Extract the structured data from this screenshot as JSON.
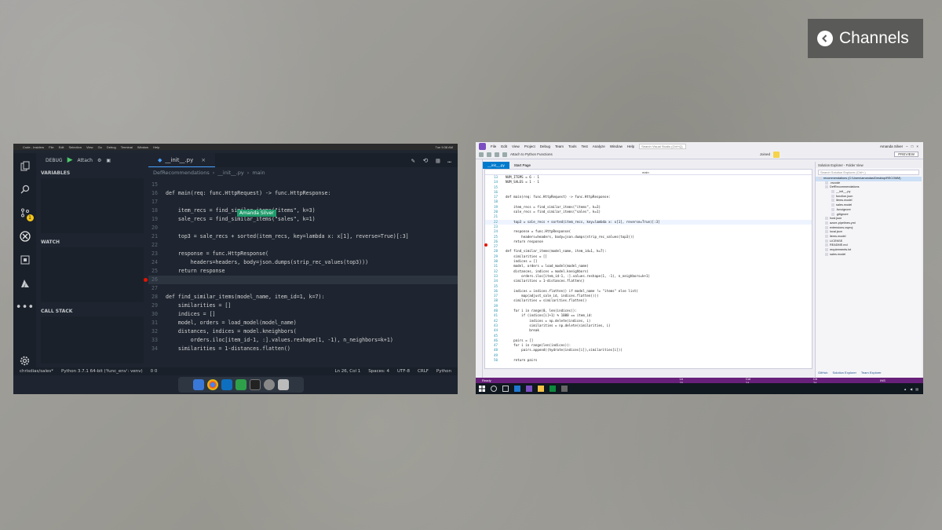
{
  "overlay": {
    "channels_label": "Channels"
  },
  "left_window": {
    "mac_menu": [
      "Code - Insiders",
      "File",
      "Edit",
      "Selection",
      "View",
      "Go",
      "Debug",
      "Terminal",
      "Window",
      "Help"
    ],
    "mac_clock": "Tue 9:38 AM",
    "debug_label": "DEBUG",
    "attach_label": "Attach",
    "sections": {
      "variables": "VARIABLES",
      "watch": "WATCH",
      "call_stack": "CALL STACK"
    },
    "tab_label": "__init__.py",
    "breadcrumbs": [
      "DefRecommendations",
      "__init__.py",
      "main"
    ],
    "live_share_user": "Amanda Silver",
    "code": [
      {
        "n": "15",
        "t": ""
      },
      {
        "n": "16",
        "t": "def main(req: func.HttpRequest) -> func.HttpResponse:"
      },
      {
        "n": "17",
        "t": ""
      },
      {
        "n": "18",
        "t": "    item_recs = find_similar_items(\"items\", k=3)"
      },
      {
        "n": "19",
        "t": "    sale_recs = find_similar_items(\"sales\", k=1)"
      },
      {
        "n": "20",
        "t": ""
      },
      {
        "n": "21",
        "t": "    top3 = sale_recs + sorted(item_recs, key=lambda x: x[1], reverse=True)[:3]"
      },
      {
        "n": "22",
        "t": ""
      },
      {
        "n": "23",
        "t": "    response = func.HttpResponse("
      },
      {
        "n": "24",
        "t": "        headers=headers, body=json.dumps(strip_rec_values(top3)))"
      },
      {
        "n": "25",
        "t": "    return response"
      },
      {
        "n": "26",
        "t": ""
      },
      {
        "n": "27",
        "t": ""
      },
      {
        "n": "28",
        "t": "def find_similar_items(model_name, item_id=1, k=7):"
      },
      {
        "n": "29",
        "t": "    similarities = []"
      },
      {
        "n": "30",
        "t": "    indices = []"
      },
      {
        "n": "31",
        "t": "    model, orders = load_model(model_name)"
      },
      {
        "n": "32",
        "t": "    distances, indices = model.kneighbors("
      },
      {
        "n": "33",
        "t": "        orders.iloc[item_id-1, :].values.reshape(1, -1), n_neighbors=k+1)"
      },
      {
        "n": "34",
        "t": "    similarities = 1-distances.flatten()"
      }
    ],
    "status": {
      "branch": "chrisdias/sales*",
      "interpreter": "Python 3.7.1 64-bit ('func_env': venv)",
      "problems": "0 0",
      "position": "Ln 26, Col 1",
      "spaces": "Spaces: 4",
      "encoding": "UTF-8",
      "eol": "CRLF",
      "language": "Python"
    }
  },
  "right_window": {
    "menu": [
      "File",
      "Edit",
      "View",
      "Project",
      "Debug",
      "Team",
      "Tools",
      "Test",
      "Analyze",
      "Window",
      "Help"
    ],
    "search_placeholder": "Search Visual Studio (Ctrl+Q)",
    "user": "Amanda Silver",
    "toolbar_attach": "Attach to Python Functions",
    "toolbar_status": "Joined",
    "preview_label": "PREVIEW",
    "tabs": [
      "__init__.py",
      "Start Page"
    ],
    "breadcrumb": "main",
    "code": [
      {
        "n": "13",
        "t": "NUM_ITEMS = 6 - 1"
      },
      {
        "n": "14",
        "t": "NUM_SALES = 1 - 1"
      },
      {
        "n": "15",
        "t": ""
      },
      {
        "n": "16",
        "t": ""
      },
      {
        "n": "17",
        "t": "def main(req: func.HttpRequest) -> func.HttpResponse:"
      },
      {
        "n": "18",
        "t": ""
      },
      {
        "n": "19",
        "t": "    item_recs = find_similar_items(\"items\", k=3)"
      },
      {
        "n": "20",
        "t": "    sale_recs = find_similar_items(\"sales\", k=1)"
      },
      {
        "n": "21",
        "t": ""
      },
      {
        "n": "22",
        "t": "    top3 = sale_recs + sorted(item_recs, key=lambda x: x[1], reverse=True)[:3]"
      },
      {
        "n": "23",
        "t": ""
      },
      {
        "n": "24",
        "t": "    response = func.HttpResponse("
      },
      {
        "n": "25",
        "t": "        headers=headers, body=json.dumps(strip_rec_values(top3)))"
      },
      {
        "n": "26",
        "t": "    return response"
      },
      {
        "n": "27",
        "t": ""
      },
      {
        "n": "28",
        "t": "def find_similar_items(model_name, item_id=1, k=7):"
      },
      {
        "n": "29",
        "t": "    similarities = []"
      },
      {
        "n": "30",
        "t": "    indices = []"
      },
      {
        "n": "31",
        "t": "    model, orders = load_model(model_name)"
      },
      {
        "n": "32",
        "t": "    distances, indices = model.kneighbors("
      },
      {
        "n": "33",
        "t": "        orders.iloc[item_id-1, :].values.reshape(1, -1), n_neighbors=k+1)"
      },
      {
        "n": "34",
        "t": "    similarities = 1-distances.flatten()"
      },
      {
        "n": "35",
        "t": ""
      },
      {
        "n": "36",
        "t": "    indices = indices.flatten() if model_name != \"items\" else list("
      },
      {
        "n": "37",
        "t": "        map(adjust_sale_id, indices.flatten()))"
      },
      {
        "n": "38",
        "t": "    similarities = similarities.flatten()"
      },
      {
        "n": "39",
        "t": ""
      },
      {
        "n": "40",
        "t": "    for i in range(0, len(indices)):"
      },
      {
        "n": "41",
        "t": "        if (indices[i]+1) % 1000 == item_id:"
      },
      {
        "n": "42",
        "t": "            indices = np.delete(indices, i)"
      },
      {
        "n": "43",
        "t": "            similarities = np.delete(similarities, i)"
      },
      {
        "n": "44",
        "t": "            break"
      },
      {
        "n": "45",
        "t": ""
      },
      {
        "n": "46",
        "t": "    pairs = []"
      },
      {
        "n": "47",
        "t": "    for i in range(len(indices)):"
      },
      {
        "n": "48",
        "t": "        pairs.append((hydrate(indices[i]),similarities[i]))"
      },
      {
        "n": "49",
        "t": ""
      },
      {
        "n": "50",
        "t": "    return pairs"
      }
    ],
    "solution_title": "Solution Explorer - Folder View",
    "solution_search": "Search Solution Explorer (Ctrl+;)",
    "solution_items": [
      "recommendations (C:\\Users\\amandas\\Desktop\\RECOMM)",
      ".vscode",
      "DefRecommendations",
      "__init__.py",
      "function.json",
      "items.model",
      "sales.model",
      ".funcignore",
      ".gitignore",
      "host.json",
      "azure-pipelines.yml",
      "extensions.csproj",
      "local.json",
      "items.model",
      "LICENSE",
      "README.md",
      "requirements.txt",
      "sales.model"
    ],
    "solution_tabs": [
      "GitHub",
      "Solution Explorer",
      "Team Explorer"
    ],
    "status": {
      "ready": "Ready",
      "ln": "Ln 22",
      "col": "Col 24",
      "ch": "Ch 24",
      "ins": "INS",
      "repo": "recommendat"
    },
    "zoom": "100 %"
  }
}
